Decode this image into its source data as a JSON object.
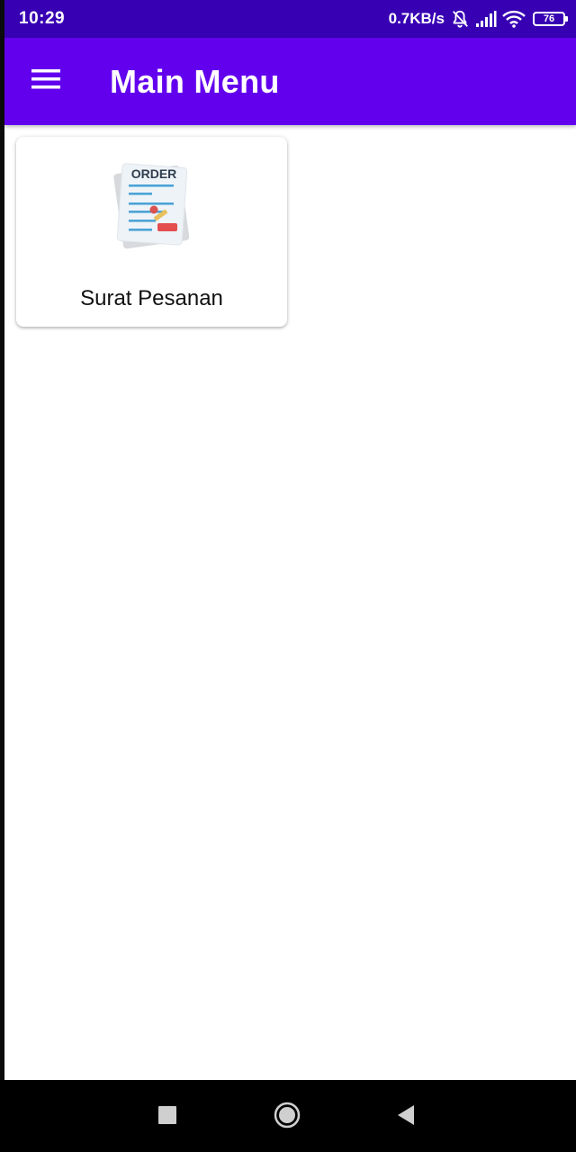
{
  "status_bar": {
    "time": "10:29",
    "network_speed": "0.7KB/s",
    "battery_level": "76",
    "icons": [
      "mute-bell-icon",
      "signal-icon",
      "wifi-icon",
      "battery-icon"
    ]
  },
  "app_bar": {
    "title": "Main Menu",
    "menu_icon": "hamburger-menu-icon"
  },
  "menu_items": [
    {
      "label": "Surat Pesanan",
      "icon": "order-document-icon",
      "icon_text": "ORDER"
    }
  ],
  "nav_bar": {
    "buttons": [
      "recents-button",
      "home-button",
      "back-button"
    ]
  },
  "colors": {
    "status_bar": "#3700b3",
    "app_bar": "#6200ee",
    "background": "#ffffff"
  }
}
